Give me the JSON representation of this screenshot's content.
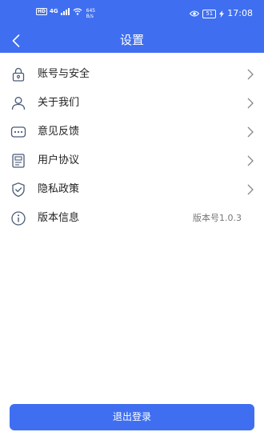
{
  "status_bar": {
    "hd": "HD",
    "signal": "4G",
    "net_speed_value": "645",
    "net_speed_unit": "B/s",
    "battery": "51",
    "time": "17:08"
  },
  "header": {
    "title": "设置"
  },
  "settings": {
    "items": [
      {
        "label": "账号与安全",
        "icon": "lock-icon"
      },
      {
        "label": "关于我们",
        "icon": "user-icon"
      },
      {
        "label": "意见反馈",
        "icon": "message-icon"
      },
      {
        "label": "用户协议",
        "icon": "document-icon"
      },
      {
        "label": "隐私政策",
        "icon": "shield-icon"
      },
      {
        "label": "版本信息",
        "icon": "info-icon",
        "value": "版本号1.0.3"
      }
    ]
  },
  "logout": {
    "label": "退出登录"
  },
  "colors": {
    "accent": "#3f6ff0",
    "icon_stroke": "#4a5a78"
  }
}
